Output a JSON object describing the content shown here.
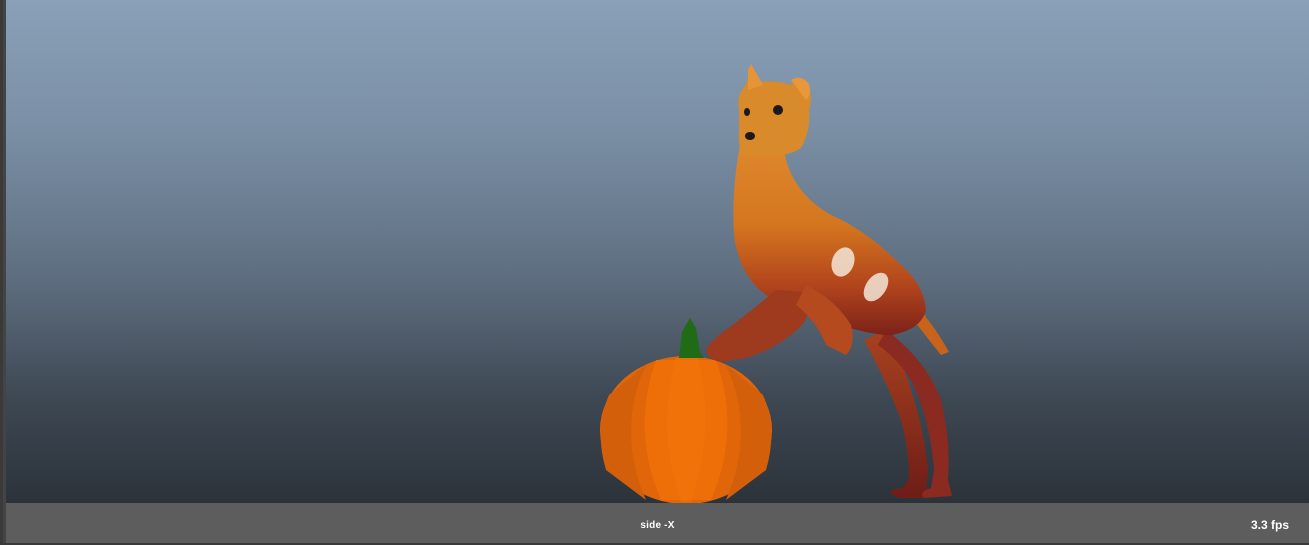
{
  "viewport": {
    "camera_name": "side -X",
    "fps_readout": "3.3 fps"
  },
  "scene": {
    "objects": [
      "pumpkin",
      "dog"
    ],
    "colors": {
      "bg_top": "#8aa0b8",
      "bg_bottom": "#2b323a",
      "pumpkin": "#e8680a",
      "stem": "#1f6b16",
      "dog_body": "#d77b22",
      "dog_legs": "#8a2a20",
      "hud": "#5d5d5d"
    }
  }
}
